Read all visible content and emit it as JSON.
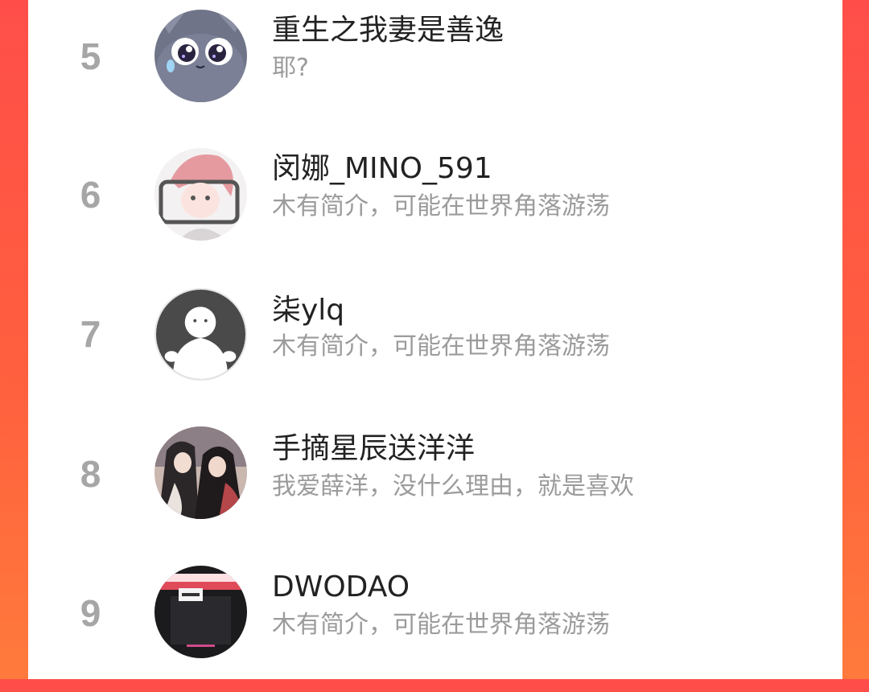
{
  "colors": {
    "background_gradient_top": "#ff4e4a",
    "background_gradient_bottom": "#ff7a3c",
    "card": "#ffffff",
    "rank_text": "#a6a6a6",
    "name_text": "#222222",
    "bio_text": "#9b9b9b"
  },
  "ranking": {
    "entries": [
      {
        "rank": "5",
        "name": "重生之我妻是善逸",
        "bio": "耶?",
        "avatar_icon": "cartoon-cat-avatar-icon"
      },
      {
        "rank": "6",
        "name": "闵娜_MINO_591",
        "bio": "木有简介，可能在世界角落游荡",
        "avatar_icon": "anime-boy-avatar-icon"
      },
      {
        "rank": "7",
        "name": "柒ylq",
        "bio": "木有简介，可能在世界角落游荡",
        "avatar_icon": "default-person-avatar-icon"
      },
      {
        "rank": "8",
        "name": "手摘星辰送洋洋",
        "bio": "我爱薛洋，没什么理由，就是喜欢",
        "avatar_icon": "anime-couple-avatar-icon"
      },
      {
        "rank": "9",
        "name": "DWODAO",
        "bio": "木有简介，可能在世界角落游荡",
        "avatar_icon": "photo-avatar-icon"
      }
    ]
  }
}
